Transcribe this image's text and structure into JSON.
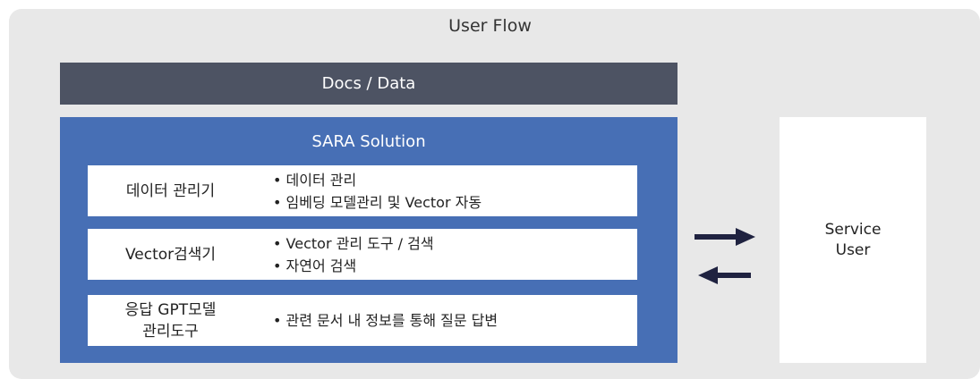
{
  "user_flow": {
    "title": "User Flow"
  },
  "docs": {
    "label": "Docs / Data"
  },
  "sara": {
    "title": "SARA Solution",
    "rows": [
      {
        "name": "데이터 관리기",
        "bullets": [
          "데이터 관리",
          "임베딩 모델관리 및 Vector 자동"
        ]
      },
      {
        "name": "Vector검색기",
        "bullets": [
          "Vector 관리 도구 / 검색",
          "자연어 검색"
        ]
      },
      {
        "name_lines": [
          "응답 GPT모델",
          "관리도구"
        ],
        "bullets": [
          "관련 문서 내 정보를 통해 질문 답변"
        ]
      }
    ]
  },
  "service": {
    "lines": [
      "Service",
      "User"
    ]
  },
  "arrows": {
    "forward": "right-arrow",
    "back": "left-arrow"
  },
  "colors": {
    "outer_bg": "#e8e8e8",
    "docs_bar": "#4d5363",
    "sara_box": "#476fb5",
    "arrow": "#1f2240"
  }
}
